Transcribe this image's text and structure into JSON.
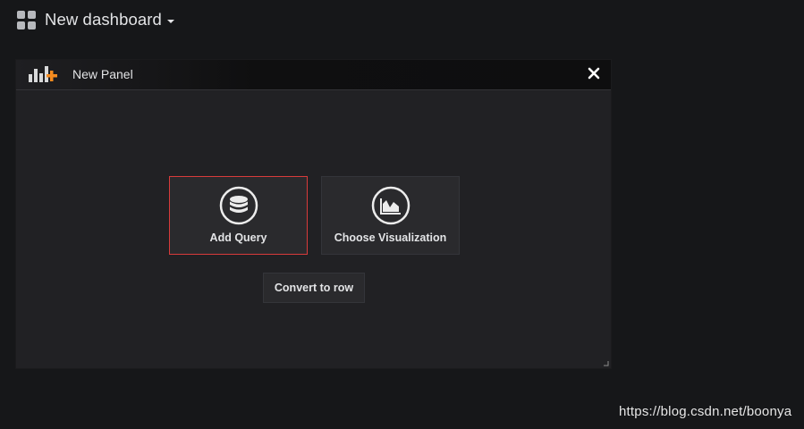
{
  "header": {
    "dashboard_title": "New dashboard",
    "icons": {
      "dashboard": "grid-icon",
      "dropdown": "caret-down-icon"
    }
  },
  "panel": {
    "title": "New Panel",
    "icons": {
      "header": "add-panel-icon",
      "close": "close-icon",
      "resize": "resize-handle-icon"
    },
    "actions": [
      {
        "label": "Add Query",
        "icon": "database-icon",
        "selected": true
      },
      {
        "label": "Choose Visualization",
        "icon": "area-chart-icon",
        "selected": false
      }
    ],
    "convert_label": "Convert to row"
  },
  "watermark": "https://blog.csdn.net/boonya",
  "colors": {
    "background": "#161719",
    "panel": "#212124",
    "button": "#2a2a2d",
    "highlight_border": "#d83b3b",
    "accent_orange": "#f58b1f"
  }
}
